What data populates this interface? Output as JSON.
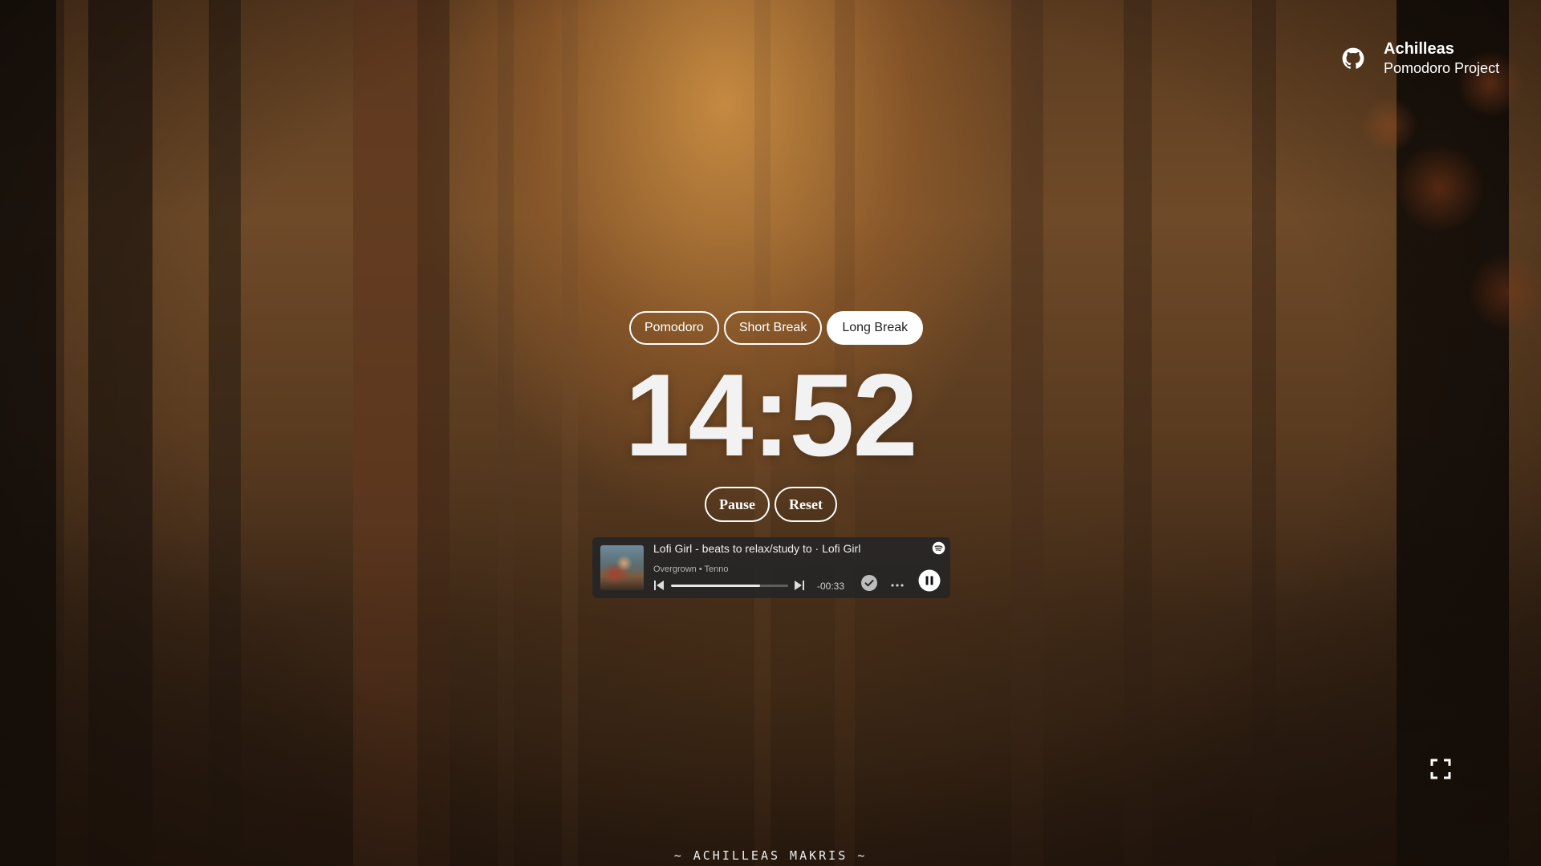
{
  "profile": {
    "name": "Achilleas",
    "subtitle": "Pomodoro Project",
    "icon": "github-icon"
  },
  "tabs": [
    {
      "label": "Pomodoro",
      "active": false
    },
    {
      "label": "Short Break",
      "active": false
    },
    {
      "label": "Long Break",
      "active": true
    }
  ],
  "timer": {
    "display": "14:52"
  },
  "controls": {
    "pause_label": "Pause",
    "reset_label": "Reset"
  },
  "player": {
    "title": "Lofi Girl - beats to relax/study to · Lofi Girl",
    "subtitle": "Overgrown • Tenno",
    "time_remaining": "-00:33",
    "progress_fraction": 0.76,
    "icons": [
      "spotify-icon",
      "previous-track-icon",
      "next-track-icon",
      "check-circle-icon",
      "more-icon",
      "pause-circle-icon"
    ]
  },
  "fullscreen": {
    "icon": "fullscreen-icon"
  },
  "footer": {
    "text": "~ ACHILLEAS MAKRIS ~"
  },
  "colors": {
    "accent": "#ffffff",
    "active_tab_text": "#222222",
    "player_bg": "#262626"
  }
}
